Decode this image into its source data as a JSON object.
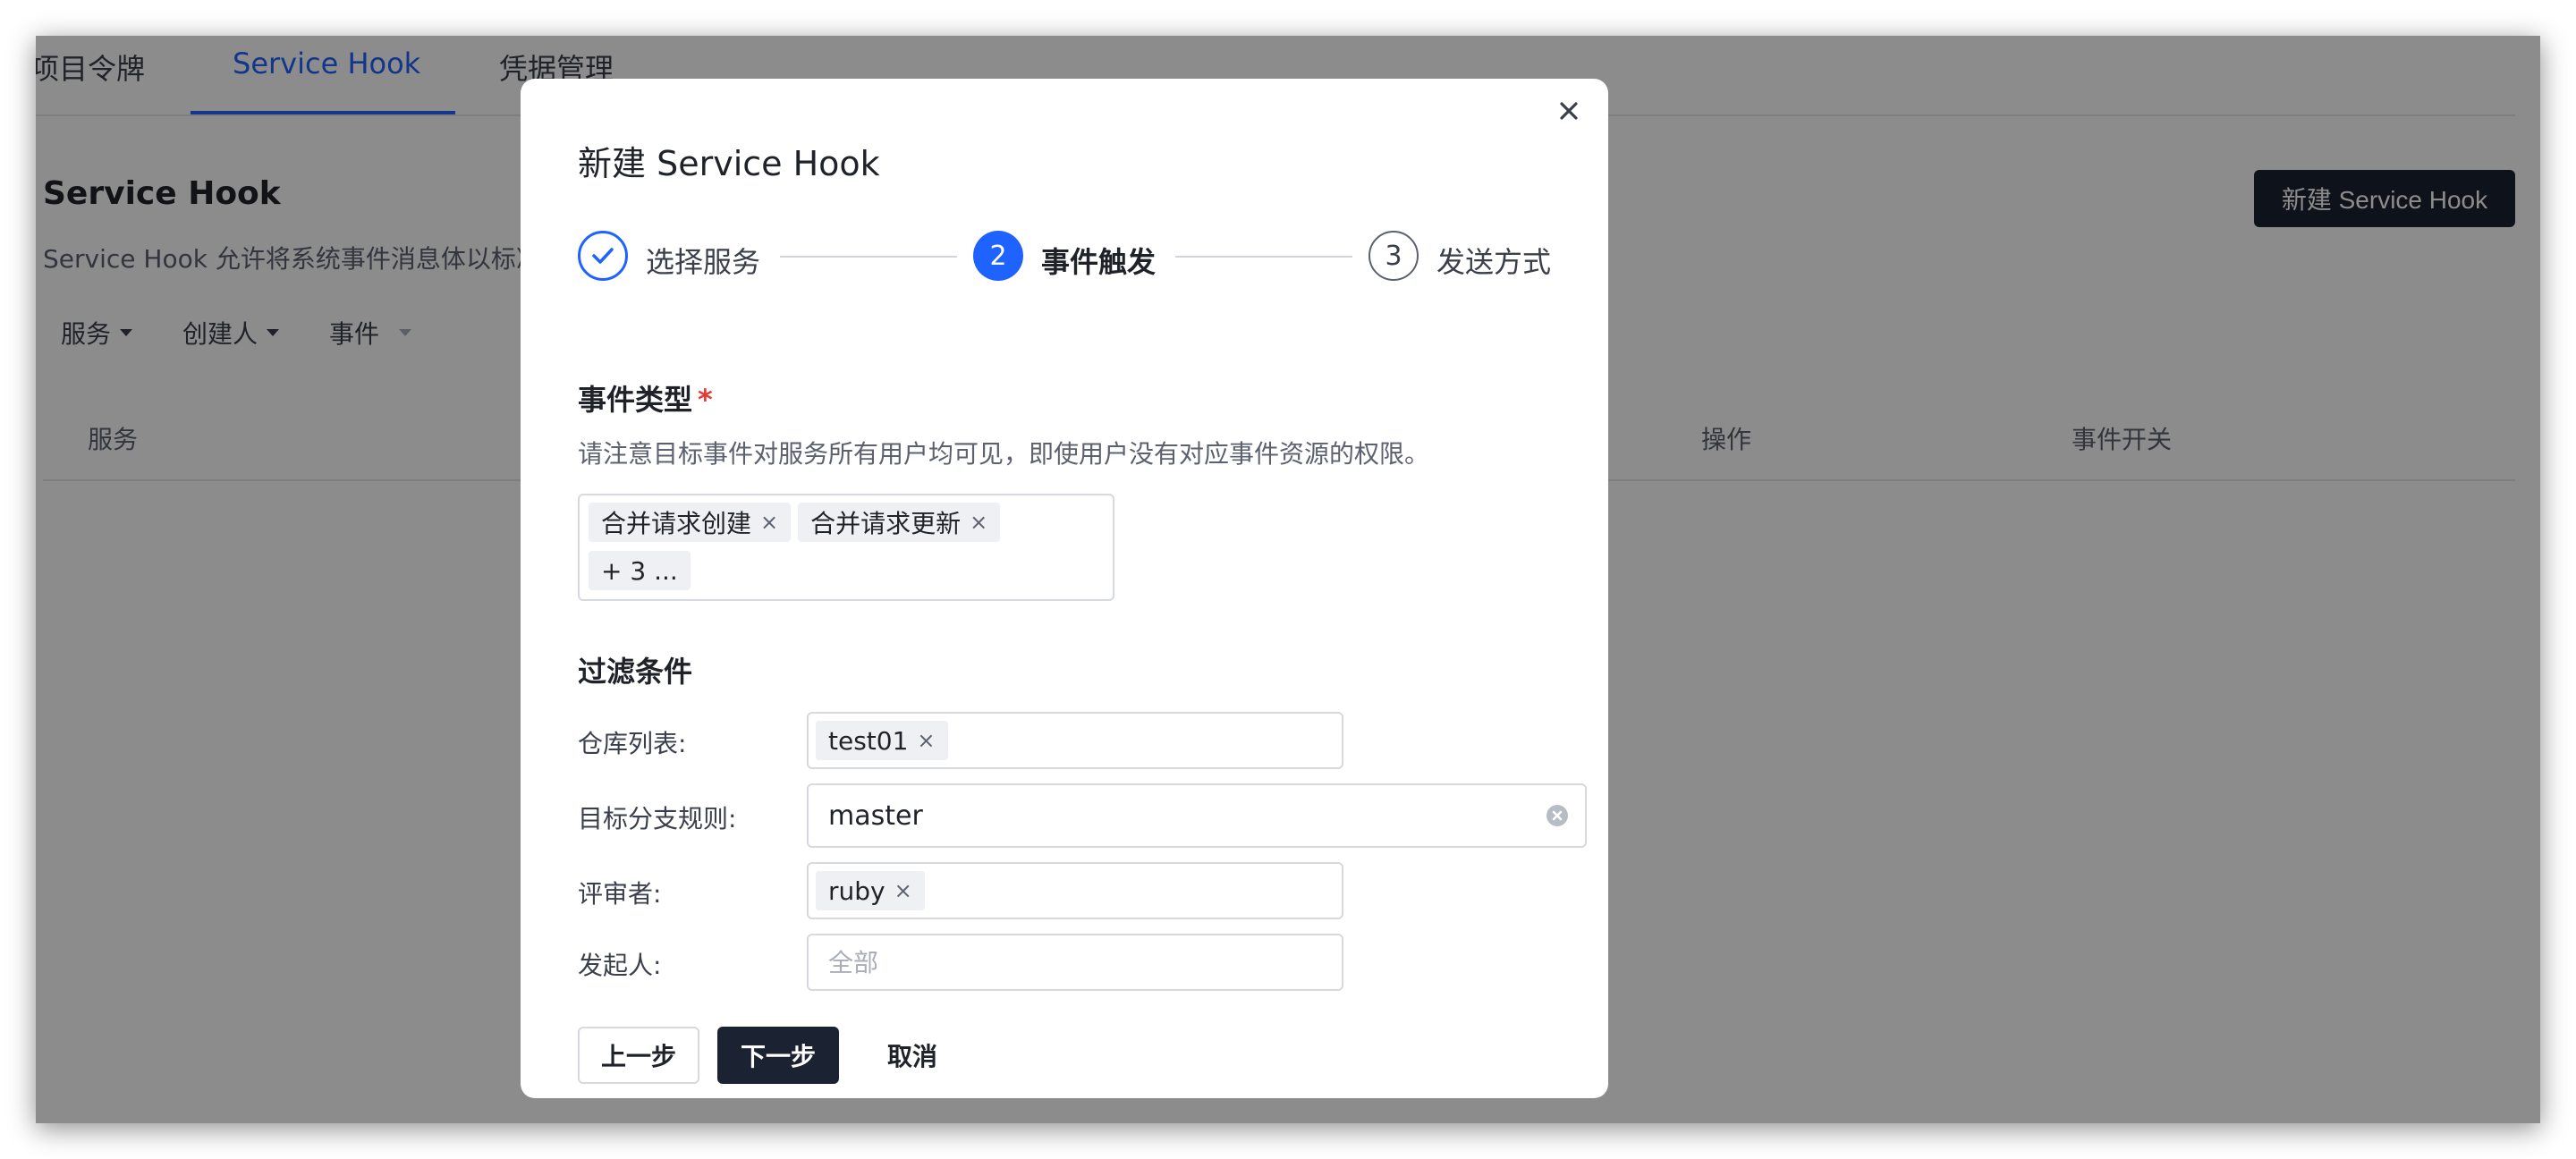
{
  "tabs": [
    {
      "label": "项目令牌",
      "active": false
    },
    {
      "label": "Service Hook",
      "active": true
    },
    {
      "label": "凭据管理",
      "active": false
    }
  ],
  "page": {
    "title": "Service Hook",
    "description": "Service Hook 允许将系统事件消息体以标准",
    "new_button": "新建 Service Hook"
  },
  "filters": [
    "服务",
    "创建人",
    "事件"
  ],
  "table": {
    "columns": [
      "服务",
      "操作",
      "事件开关"
    ]
  },
  "modal": {
    "title": "新建 Service Hook",
    "steps": [
      {
        "index": "1",
        "label": "选择服务",
        "status": "done"
      },
      {
        "index": "2",
        "label": "事件触发",
        "status": "current"
      },
      {
        "index": "3",
        "label": "发送方式",
        "status": "pending"
      }
    ],
    "event_type": {
      "title": "事件类型",
      "required_mark": "*",
      "hint": "请注意目标事件对服务所有用户均可见，即使用户没有对应事件资源的权限。",
      "tags": [
        "合并请求创建",
        "合并请求更新"
      ],
      "more": "+ 3 ..."
    },
    "filter": {
      "title": "过滤条件",
      "repo": {
        "label": "仓库列表:",
        "tags": [
          "test01"
        ]
      },
      "branch": {
        "label": "目标分支规则:",
        "value": "master"
      },
      "reviewer": {
        "label": "评审者:",
        "tags": [
          "ruby"
        ]
      },
      "initiator": {
        "label": "发起人:",
        "placeholder": "全部"
      }
    },
    "buttons": {
      "prev": "上一步",
      "next": "下一步",
      "cancel": "取消"
    }
  },
  "colors": {
    "accent": "#1f63ff",
    "primary_button": "#1b2232",
    "required": "#e53935",
    "overlay": "rgba(0,0,0,0.45)"
  },
  "icons": {
    "close": "close-icon",
    "check": "check-icon",
    "tag_remove": "tag-remove-icon",
    "clear": "clear-icon",
    "caret": "caret-down-icon"
  }
}
